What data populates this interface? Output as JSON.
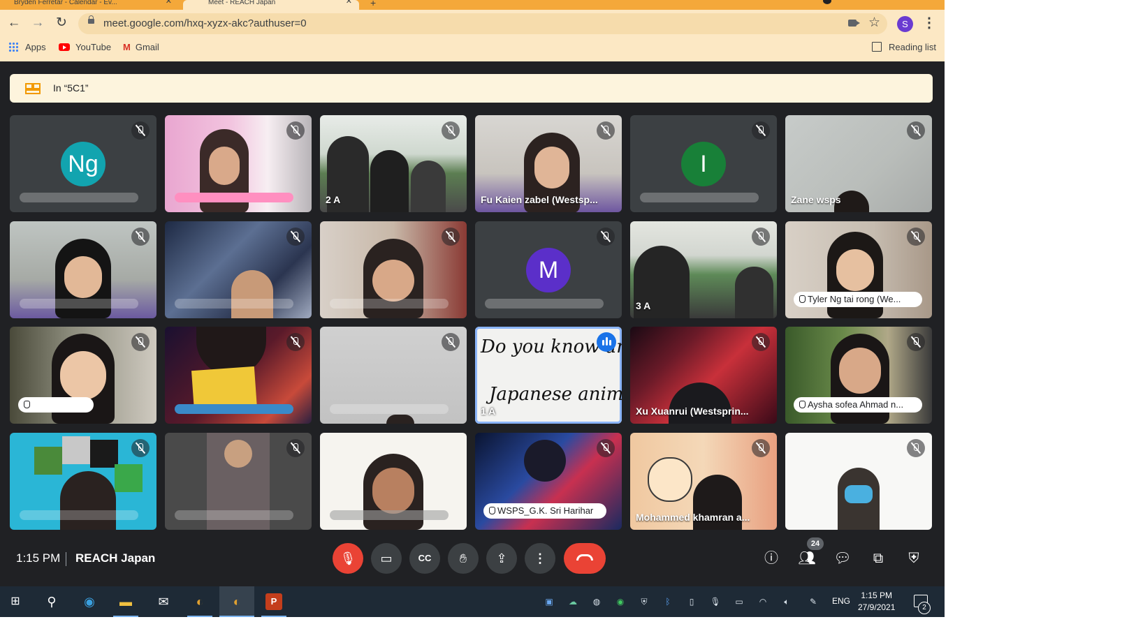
{
  "browser": {
    "tabs": [
      {
        "label": "Bryden Ferretar - Calendar - Ev..."
      },
      {
        "label": "Meet - REACH Japan"
      }
    ],
    "url": "meet.google.com/hxq-xyzx-akc?authuser=0",
    "profile_initial": "S",
    "bookmarks": [
      {
        "label": "Apps",
        "icon": "apps-grid-icon"
      },
      {
        "label": "YouTube",
        "icon": "youtube-icon"
      },
      {
        "label": "Gmail",
        "icon": "gmail-icon"
      }
    ],
    "reading_list": "Reading list"
  },
  "breakout": {
    "label": "In “5C1”"
  },
  "participants": [
    {
      "name": "",
      "initial": "Ng",
      "avatar_color": "#12a4af",
      "muted": true
    },
    {
      "name": "",
      "muted": true
    },
    {
      "name": "2 A",
      "muted": true
    },
    {
      "name": "Fu Kaien zabel (Westsp...",
      "muted": true
    },
    {
      "name": "",
      "initial": "I",
      "avatar_color": "#188038",
      "muted": true
    },
    {
      "name": "Zane wsps",
      "muted": true
    },
    {
      "name": "",
      "muted": true
    },
    {
      "name": "",
      "muted": true
    },
    {
      "name": "",
      "muted": true
    },
    {
      "name": "",
      "initial": "M",
      "avatar_color": "#5b2fc9",
      "muted": true
    },
    {
      "name": "3 A",
      "muted": true
    },
    {
      "name": "Tyler Ng tai rong (We...",
      "muted": true,
      "hand_raised": true
    },
    {
      "name": "",
      "muted": true,
      "hand_raised": true
    },
    {
      "name": "",
      "muted": true
    },
    {
      "name": "",
      "muted": true
    },
    {
      "name": "1 A",
      "muted": false,
      "speaking": true,
      "shown_text": [
        "Do you know any",
        "Japanese animes"
      ]
    },
    {
      "name": "Xu Xuanrui (Westsprin...",
      "muted": true
    },
    {
      "name": "Aysha sofea Ahmad n...",
      "muted": true,
      "hand_raised": true
    },
    {
      "name": "",
      "muted": true
    },
    {
      "name": "",
      "muted": true
    },
    {
      "name": "",
      "muted": false
    },
    {
      "name": "WSPS_G.K. Sri Harihar",
      "muted": true,
      "hand_raised": true
    },
    {
      "name": "Mohammed khamran a...",
      "muted": true
    },
    {
      "name": "",
      "muted": true
    }
  ],
  "meeting": {
    "time": "1:15 PM",
    "name": "REACH Japan",
    "people_count": "24",
    "mic_state": "muted"
  },
  "taskbar": {
    "language": "ENG",
    "time": "1:15 PM",
    "date": "27/9/2021",
    "notifications": "2"
  },
  "colors": {
    "tabstrip": "#f4a83a",
    "toolbar": "#fce8c4",
    "meet_bg": "#202124",
    "hangup": "#ea4335",
    "speaking_outline": "#8ab4f8"
  }
}
